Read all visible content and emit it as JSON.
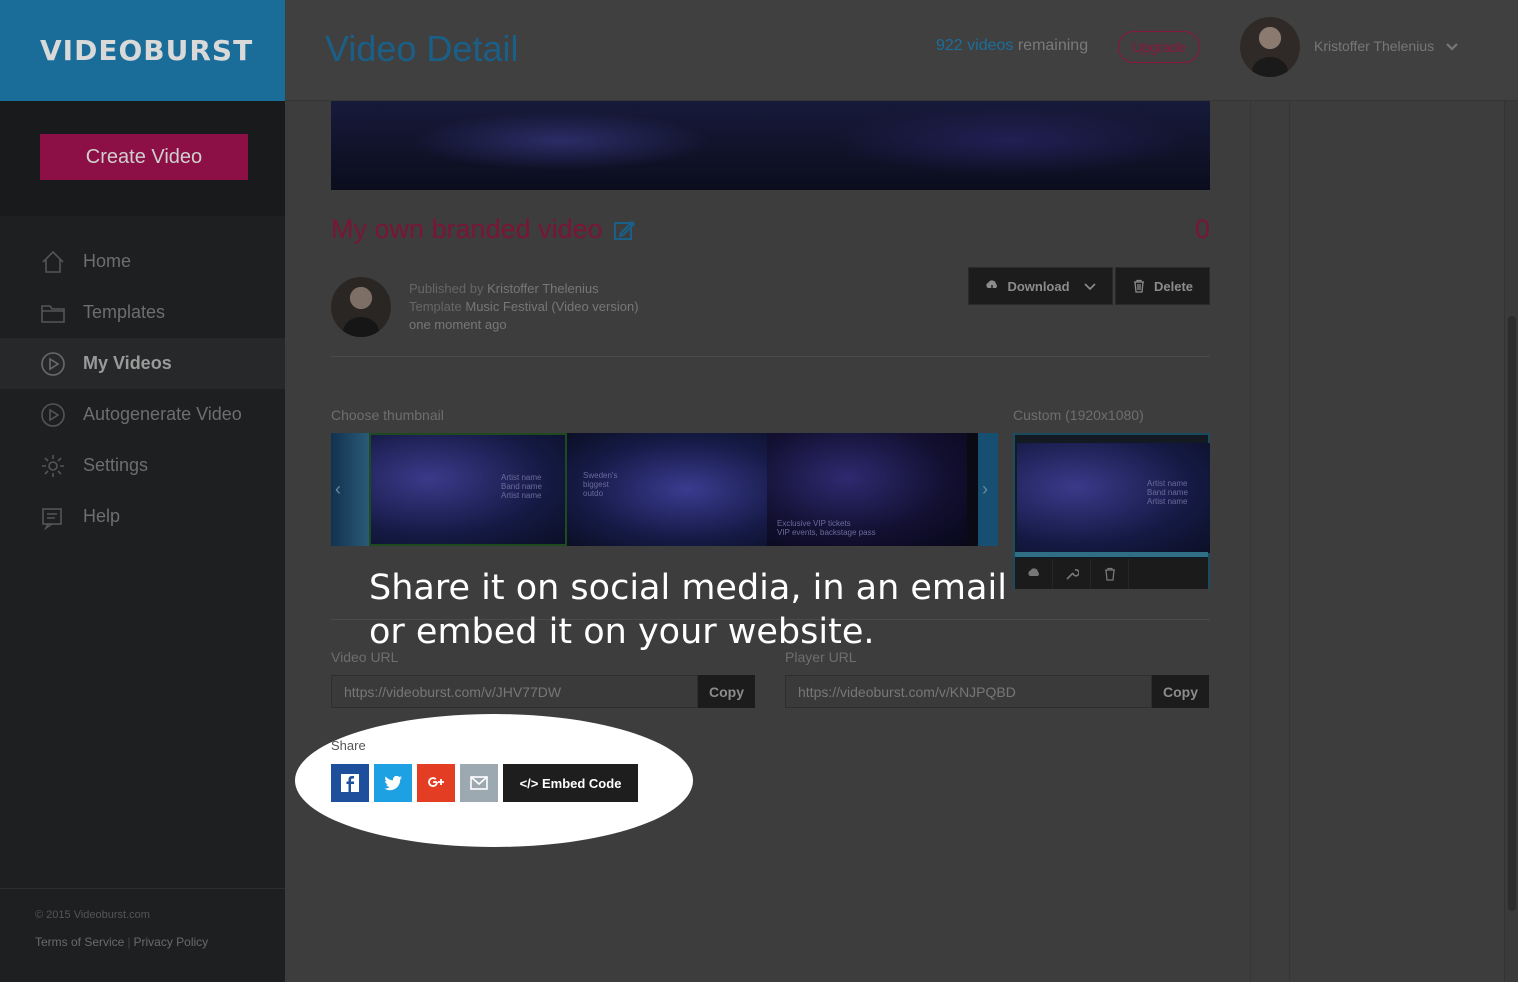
{
  "brand": {
    "logo_text": "VIDEOBURST"
  },
  "sidebar": {
    "create_label": "Create Video",
    "items": [
      {
        "label": "Home",
        "icon": "home-icon"
      },
      {
        "label": "Templates",
        "icon": "folder-icon"
      },
      {
        "label": "My Videos",
        "icon": "play-circle-icon"
      },
      {
        "label": "Autogenerate Video",
        "icon": "play-circle-icon"
      },
      {
        "label": "Settings",
        "icon": "gear-icon"
      },
      {
        "label": "Help",
        "icon": "help-icon"
      }
    ],
    "copyright": "© 2015 Videoburst.com",
    "terms": "Terms of Service",
    "privacy": "Privacy Policy"
  },
  "header": {
    "title": "Video Detail",
    "remaining_count": "922 videos",
    "remaining_suffix": "remaining",
    "upgrade_label": "Upgrade",
    "user_name": "Kristoffer Thelenius"
  },
  "video": {
    "title": "My own branded video",
    "count": "0",
    "published_by_label": "Published by",
    "publisher": "Kristoffer Thelenius",
    "template_label": "Template",
    "template_name": "Music Festival (Video version)",
    "time": "one moment ago",
    "download_label": "Download",
    "delete_label": "Delete"
  },
  "thumbnails": {
    "choose_label": "Choose thumbnail",
    "custom_label": "Custom (1920x1080)",
    "t1_text": "Artist name\nBand name\nArtist name",
    "t2_text": "Sweden's\nbiggest\noutdo",
    "t3_text": "Exclusive VIP tickets\nVIP events, backstage pass",
    "custom_text": "Artist name\nBand name\nArtist name"
  },
  "overlay": {
    "line1": "Share it on social media, in an email",
    "line2": "or embed it on your website."
  },
  "urls": {
    "video_label": "Video URL",
    "video_value": "https://videoburst.com/v/JHV77DW",
    "player_label": "Player URL",
    "player_value": "https://videoburst.com/v/KNJPQBD",
    "copy_label": "Copy"
  },
  "share": {
    "label": "Share",
    "embed_label": "</> Embed Code"
  },
  "colors": {
    "logo_bg": "#1a6c99",
    "accent_pink": "#8c0f45",
    "facebook": "#1d4f9c",
    "twitter": "#1da1e2",
    "google_plus": "#e33d24",
    "email": "#9da9b0"
  }
}
